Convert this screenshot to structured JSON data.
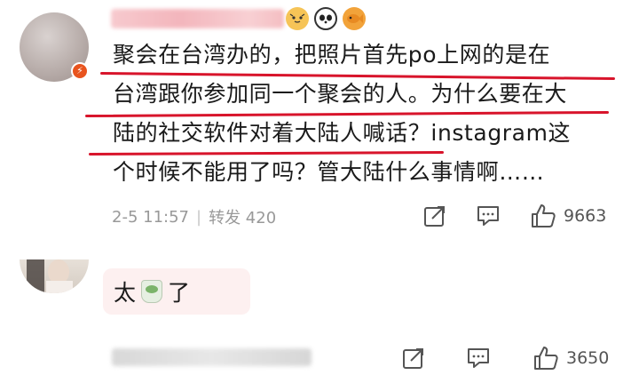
{
  "comment": {
    "username": "",
    "emojis": [
      "tiger-emoji",
      "panda-emoji",
      "fish-emoji"
    ],
    "lines": [
      "聚会在台湾办的，把照片首先po上网的是在",
      "台湾跟你参加同一个聚会的人。为什么要在大",
      "陆的社交软件对着大陆人喊话？instagram这",
      "个时候不能用了吗？管大陆什么事情啊……"
    ],
    "timestamp": "2-5 11:57",
    "separator": "|",
    "repost_label": "转发 420",
    "like_count": "9663"
  },
  "reply": {
    "text_before": "太",
    "emoji": "tea-emoji",
    "text_after": "了",
    "like_count": "3650"
  },
  "colors": {
    "underline": "#d8142b",
    "badge": "#e8541e",
    "meta_text": "#999999",
    "reply_bubble": "#fdf0f0"
  }
}
